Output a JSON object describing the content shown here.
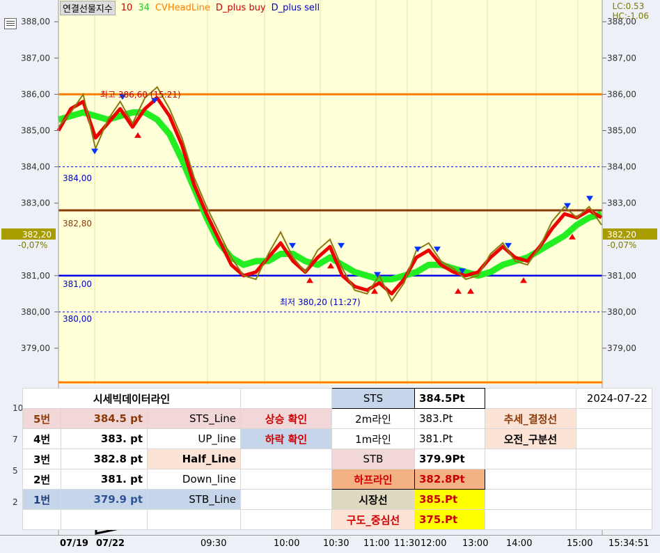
{
  "legend": {
    "symbol": "연결선물지수",
    "p1": "10",
    "p2": "34",
    "l3": "CVHeadLine",
    "l4": "D_plus buy",
    "l5": "D_plus sell"
  },
  "readout": {
    "lc": "LC:0.53",
    "hc": "HC:-1.06"
  },
  "y_ticks": [
    "388,00",
    "387,00",
    "386,00",
    "385,00",
    "384,00",
    "383,00",
    "382,20",
    "381,00",
    "380,00",
    "379,00"
  ],
  "pct": "-0,07%",
  "annotations": {
    "high": "최고 386,60 (15:21)",
    "low": "최저 380,20 (11:27)",
    "l384": "384,00",
    "l383": "382,80",
    "l3828": "383,00",
    "l381": "381,00",
    "l380": "380,00",
    "l386": "385,00"
  },
  "left_sub_ticks": [
    "10",
    "7",
    "5",
    "2"
  ],
  "table": {
    "title": "시세빅데이터라인",
    "date": "2024-07-22",
    "rows": [
      {
        "no": "5번",
        "pt": "384.5 pt",
        "name": "STS_Line",
        "sig": "상승 확인",
        "k": "STS",
        "v": "384.5Pt",
        "extra": "추세_결정선"
      },
      {
        "no": "4번",
        "pt": "383. pt",
        "name": "UP_line",
        "sig": "하락 확인",
        "k": "2m라인",
        "v": "383.Pt",
        "extra": "오전_구분선"
      },
      {
        "no": "3번",
        "pt": "382.8 pt",
        "name": "Half_Line",
        "sig": "",
        "k": "1m라인",
        "v": "381.Pt",
        "extra": ""
      },
      {
        "no": "2번",
        "pt": "381. pt",
        "name": "Down_line",
        "sig": "",
        "k": "STB",
        "v": "379.9Pt",
        "extra": ""
      },
      {
        "no": "1번",
        "pt": "379.9 pt",
        "name": "STB_Line",
        "sig": "",
        "k": "하프라인",
        "v": "382.8Pt",
        "extra": ""
      },
      {
        "no": "",
        "pt": "",
        "name": "",
        "sig": "",
        "k": "시장선",
        "v": "385.Pt",
        "extra": ""
      },
      {
        "no": "",
        "pt": "",
        "name": "",
        "sig": "",
        "k": "구도_중심선",
        "v": "375.Pt",
        "extra": ""
      }
    ]
  },
  "x_labels": [
    "07/19",
    "07/22",
    "09:30",
    "10:00",
    "10:30",
    "11:00",
    "11:30",
    "12:00",
    "13:00",
    "14:00",
    "15:00",
    "15:34:51"
  ],
  "colors": {
    "bg": "#ffffd8",
    "orange": "#ff8000",
    "blue": "#0000ee",
    "brown": "#8b3a0a",
    "green": "#22ee22",
    "red": "#ee0000",
    "olive": "#8a7a10"
  },
  "chart_data": {
    "type": "line",
    "ylim": [
      378,
      388.6
    ],
    "hlines": [
      {
        "y": 386.0,
        "label": "최고"
      },
      {
        "y": 384.0,
        "label": "384,00"
      },
      {
        "y": 383.0,
        "label": "383,00"
      },
      {
        "y": 382.8,
        "label": "382,80"
      },
      {
        "y": 381.0,
        "label": "381,00"
      },
      {
        "y": 380.0,
        "label": "380,00"
      }
    ],
    "series": [
      {
        "name": "연결선물지수",
        "values": [
          385.1,
          385.5,
          386.0,
          384.5,
          385.3,
          385.8,
          385.2,
          385.9,
          386.2,
          385.6,
          384.8,
          383.7,
          382.9,
          382.2,
          381.5,
          381.0,
          380.9,
          381.6,
          382.2,
          381.5,
          381.1,
          381.7,
          382.0,
          381.2,
          380.6,
          380.5,
          381.0,
          380.3,
          380.8,
          381.7,
          381.9,
          381.4,
          381.2,
          380.9,
          381.0,
          381.6,
          381.9,
          381.4,
          381.3,
          381.8,
          382.5,
          382.9,
          382.6,
          382.9,
          382.4
        ]
      },
      {
        "name": "CVHeadLine",
        "values": [
          385.3,
          385.4,
          385.5,
          385.4,
          385.3,
          385.4,
          385.5,
          385.5,
          385.3,
          384.9,
          384.2,
          383.4,
          382.6,
          381.9,
          381.5,
          381.3,
          381.4,
          381.4,
          381.6,
          381.6,
          381.4,
          381.3,
          381.5,
          381.3,
          381.1,
          381.0,
          380.9,
          380.9,
          381.0,
          381.1,
          381.3,
          381.3,
          381.2,
          381.1,
          381.0,
          381.1,
          381.3,
          381.4,
          381.5,
          381.7,
          381.9,
          382.1,
          382.4,
          382.6,
          382.7
        ]
      },
      {
        "name": "10",
        "values": [
          385.0,
          385.6,
          385.8,
          384.8,
          385.2,
          385.6,
          385.1,
          385.6,
          385.9,
          385.4,
          384.6,
          383.5,
          382.7,
          382.0,
          381.3,
          381.0,
          381.1,
          381.5,
          381.9,
          381.4,
          381.1,
          381.5,
          381.8,
          381.0,
          380.7,
          380.6,
          380.8,
          380.5,
          380.9,
          381.5,
          381.7,
          381.3,
          381.1,
          381.0,
          381.1,
          381.5,
          381.8,
          381.5,
          381.4,
          381.8,
          382.3,
          382.7,
          382.6,
          382.8,
          382.6
        ]
      }
    ]
  }
}
